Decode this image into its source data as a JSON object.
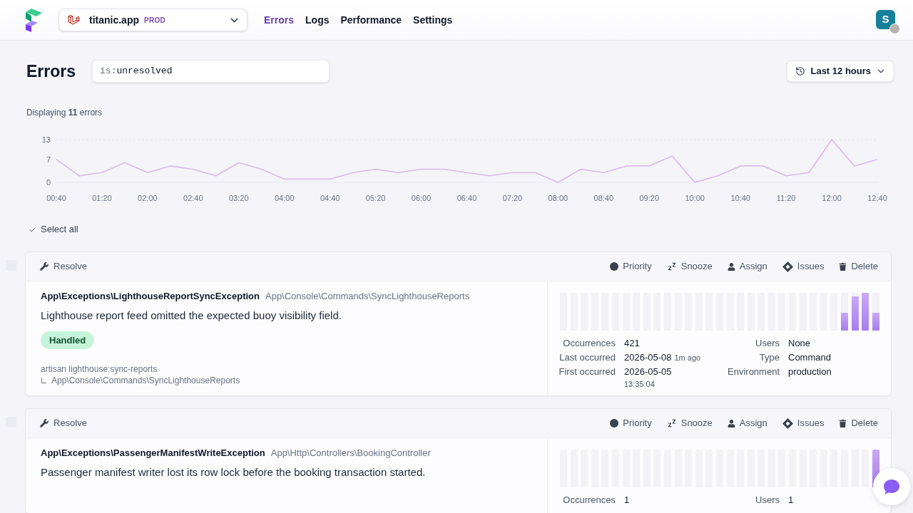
{
  "header": {
    "project": {
      "name": "titanic.app",
      "environment": "PROD"
    },
    "nav": [
      {
        "label": "Errors",
        "selected": true
      },
      {
        "label": "Logs",
        "selected": false
      },
      {
        "label": "Performance",
        "selected": false
      },
      {
        "label": "Settings",
        "selected": false
      }
    ],
    "user": {
      "initial": "S"
    }
  },
  "page": {
    "title": "Errors",
    "filter": {
      "qualifier": "is:",
      "term": "unresolved"
    },
    "time_range": "Last 12 hours",
    "summary": "Displaying **11** errors"
  },
  "chart": {
    "chart_data": {
      "type": "line",
      "x": [
        40,
        60,
        80,
        100,
        120,
        140,
        160,
        180,
        200,
        220,
        240,
        260,
        280,
        300,
        320,
        340,
        360,
        380,
        400,
        420,
        440,
        460,
        480,
        500,
        520,
        540,
        560,
        580,
        600,
        620,
        640,
        660,
        680,
        700,
        720,
        740,
        760
      ],
      "values": [
        7,
        2,
        3,
        6,
        3,
        5,
        4,
        2,
        6,
        4,
        1,
        1,
        1,
        3,
        4,
        3,
        4,
        4,
        3,
        2,
        3,
        3,
        0,
        4,
        3,
        5,
        5,
        8,
        0,
        2,
        5,
        5,
        2,
        3,
        13,
        5,
        7
      ],
      "xlim": [
        40,
        760
      ],
      "ylim": [
        0,
        13
      ],
      "yticks": [
        0,
        7,
        13
      ],
      "xticks": [
        {
          "value": 40,
          "label": "00:40"
        },
        {
          "value": 80,
          "label": "01:20"
        },
        {
          "value": 120,
          "label": "02:00"
        },
        {
          "value": 160,
          "label": "02:40"
        },
        {
          "value": 200,
          "label": "03:20"
        },
        {
          "value": 240,
          "label": "04:00"
        },
        {
          "value": 280,
          "label": "04:40"
        },
        {
          "value": 320,
          "label": "05:20"
        },
        {
          "value": 360,
          "label": "06:00"
        },
        {
          "value": 400,
          "label": "06:40"
        },
        {
          "value": 440,
          "label": "07:20"
        },
        {
          "value": 480,
          "label": "08:00"
        },
        {
          "value": 520,
          "label": "08:40"
        },
        {
          "value": 560,
          "label": "09:20"
        },
        {
          "value": 600,
          "label": "10:00"
        },
        {
          "value": 640,
          "label": "10:40"
        },
        {
          "value": 680,
          "label": "11:20"
        },
        {
          "value": 720,
          "label": "12:00"
        },
        {
          "value": 760,
          "label": "12:40"
        }
      ]
    }
  },
  "select_all": {
    "label": "Select all"
  },
  "errors": [
    {
      "checked": false,
      "resolve": "Resolve",
      "actions": [
        {
          "kind": "priority",
          "label": "Priority"
        },
        {
          "kind": "snooze",
          "label": "Snooze"
        },
        {
          "kind": "assign",
          "label": "Assign"
        },
        {
          "kind": "issues",
          "label": "Issues"
        },
        {
          "kind": "delete",
          "label": "Delete"
        }
      ],
      "exception": "App\\Exceptions\\LighthouseReportSyncException",
      "location": "App\\Console\\Commands\\SyncLighthouseReports",
      "message": "Lighthouse report feed omitted the expected buoy visibility field.",
      "badge": "Handled",
      "context": {
        "command": "artisan lighthouse:sync-reports",
        "source": "App\\Console\\Commands\\SyncLighthouseReports"
      },
      "stats": [
        {
          "label": "Occurrences",
          "value": "421"
        },
        {
          "label": "Users",
          "value": "None"
        },
        {
          "label": "Last occurred",
          "value": "2026-05-08",
          "relative": "1m ago"
        },
        {
          "label": "Type",
          "value": "Command"
        },
        {
          "label": "First occurred",
          "value": "2026-05-05",
          "time": "13:35:04"
        },
        {
          "label": "Environment",
          "value": "production"
        }
      ]
    },
    {
      "checked": false,
      "resolve": "Resolve",
      "actions": [
        {
          "kind": "priority",
          "label": "Priority"
        },
        {
          "kind": "snooze",
          "label": "Snooze"
        },
        {
          "kind": "assign",
          "label": "Assign"
        },
        {
          "kind": "issues",
          "label": "Issues"
        },
        {
          "kind": "delete",
          "label": "Delete"
        }
      ],
      "exception": "App\\Exceptions\\PassengerManifestWriteException",
      "location": "App\\Http\\Controllers\\BookingController",
      "message": "Passenger manifest writer lost its row lock before the booking transaction started.",
      "stats": [
        {
          "label": "Occurrences",
          "value": "1"
        },
        {
          "label": "Users",
          "value": "1"
        }
      ]
    }
  ]
}
